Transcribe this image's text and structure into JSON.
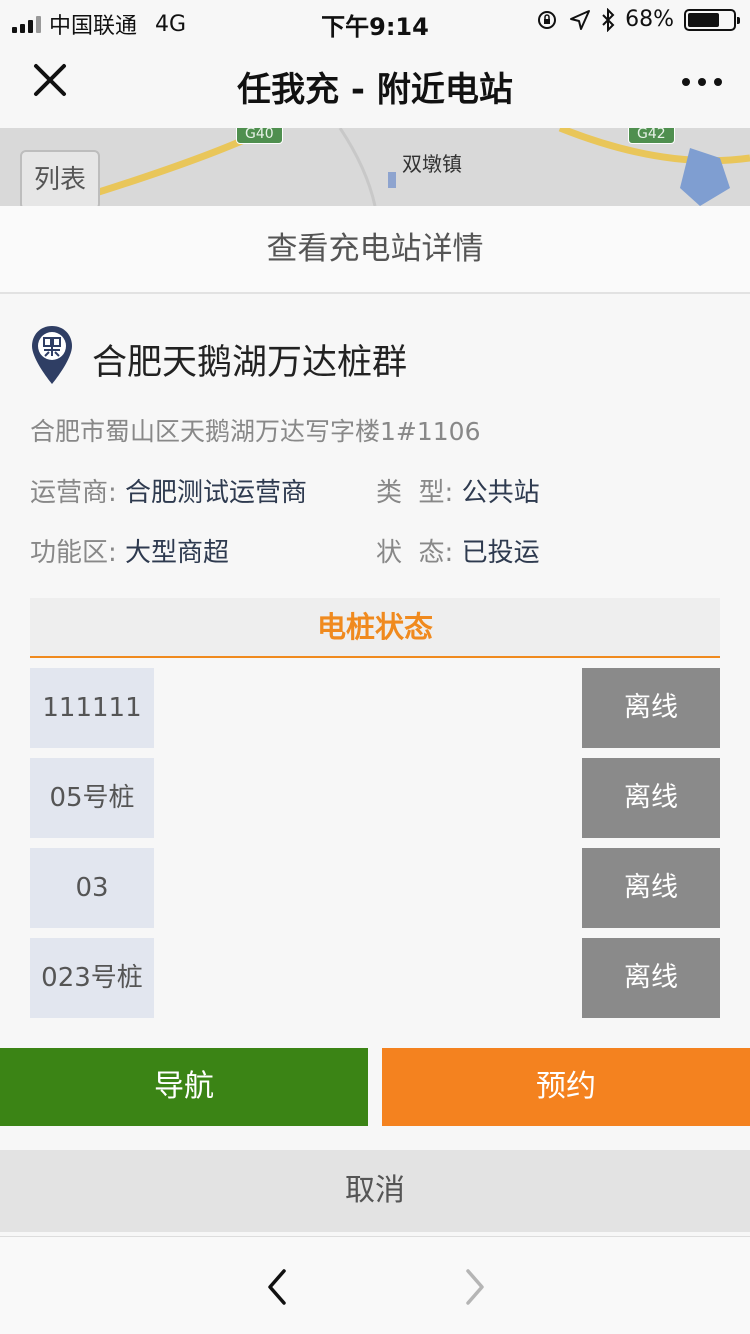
{
  "status_bar": {
    "carrier": "中国联通",
    "network": "4G",
    "time": "下午9:14",
    "battery_percent": "68%"
  },
  "nav": {
    "title": "任我充 - 附近电站",
    "close_icon": "close-icon",
    "more_icon": "more-icon"
  },
  "map": {
    "list_button": "列表",
    "place_label": "双墩镇",
    "road_badges": [
      "G40",
      "G42"
    ]
  },
  "sheet": {
    "header": "查看充电站详情",
    "station_name": "合肥天鹅湖万达桩群",
    "address": "合肥市蜀山区天鹅湖万达写字楼1#1106",
    "operator_label": "运营商:",
    "operator_value": "合肥测试运营商",
    "type_label": "类  型:",
    "type_value": "公共站",
    "area_label": "功能区:",
    "area_value": "大型商超",
    "state_label": "状  态:",
    "state_value": "已投运",
    "pile_status_title": "电桩状态",
    "piles": [
      {
        "name": "111111",
        "status": "离线"
      },
      {
        "name": "05号桩",
        "status": "离线"
      },
      {
        "name": "03",
        "status": "离线"
      },
      {
        "name": "023号桩",
        "status": "离线"
      }
    ],
    "navigate_button": "导航",
    "book_button": "预约",
    "cancel_button": "取消"
  },
  "colors": {
    "accent_orange": "#f08a1e",
    "navigate_green": "#3b8415",
    "offline_gray": "#8a8a8a"
  }
}
